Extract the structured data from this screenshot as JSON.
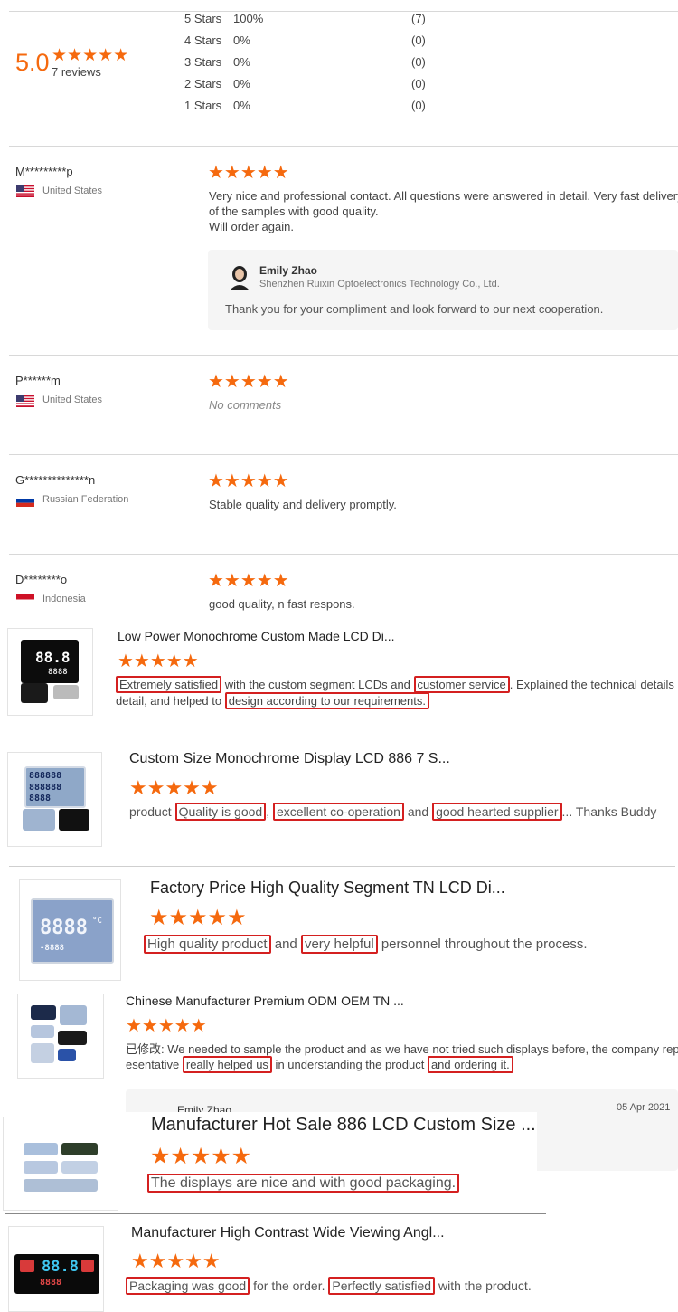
{
  "summary": {
    "score": "5.0",
    "reviews": "7 reviews",
    "breakdown": [
      {
        "label": "5 Stars",
        "pct": "100%",
        "count": "(7)"
      },
      {
        "label": "4 Stars",
        "pct": "0%",
        "count": "(0)"
      },
      {
        "label": "3 Stars",
        "pct": "0%",
        "count": "(0)"
      },
      {
        "label": "2 Stars",
        "pct": "0%",
        "count": "(0)"
      },
      {
        "label": "1 Stars",
        "pct": "0%",
        "count": "(0)"
      }
    ]
  },
  "stars": "★★★★★",
  "reviews": [
    {
      "name": "M*********p",
      "country": "United States",
      "text1": "Very nice and professional contact. All questions were answered in detail. Very fast delivery",
      "text2": "of the samples with good quality.",
      "text3": "Will order again.",
      "reply": {
        "name": "Emily Zhao",
        "company": "Shenzhen Ruixin Optoelectronics Technology Co., Ltd.",
        "text": "Thank you for your compliment and look forward to our next cooperation."
      }
    },
    {
      "name": "P******m",
      "country": "United States",
      "text": "No comments"
    },
    {
      "name": "G**************n",
      "country": "Russian Federation",
      "text": "Stable quality and delivery promptly."
    },
    {
      "name": "D********o",
      "country": "Indonesia",
      "text": "good quality, n fast respons."
    }
  ],
  "products": [
    {
      "title": "Low Power Monochrome Custom Made LCD Di...",
      "h1": "Extremely satisfied",
      "t1": " with the custom segment LCDs and ",
      "h2": "customer service",
      "t2": ". Explained the technical details in",
      "t3": "detail, and helped to ",
      "h3": "design according to our requirements."
    },
    {
      "title": "Custom Size Monochrome Display LCD 886 7 S...",
      "t0": "product ",
      "h1": "Quality is good",
      "t1": ", ",
      "h2": "excellent co-operation",
      "t2": " and ",
      "h3": "good hearted supplier",
      "t3": "... Thanks Buddy"
    },
    {
      "title": "Factory Price High Quality Segment TN LCD Di...",
      "h1": "High quality product",
      "t1": " and ",
      "h2": "very helpful",
      "t2": " personnel throughout the process."
    },
    {
      "title": "Chinese Manufacturer Premium ODM OEM TN ...",
      "t0": "已修改: We needed to sample the product and as we have not tried such displays before, the company repr",
      "t1": "esentative ",
      "h1": "really helped us",
      "t2": " in understanding the product ",
      "h2": "and ordering it.",
      "reply_name": "Emily Zhao",
      "reply_date": "05 Apr 2021"
    },
    {
      "title": "Manufacturer Hot Sale 886 LCD Custom Size ...",
      "h1": "The displays are nice and with good packaging."
    },
    {
      "title": "Manufacturer High Contrast Wide Viewing Angl...",
      "h1": "Packaging was good",
      "t1": " for the order. ",
      "h2": "Perfectly satisfied",
      "t2": " with the product."
    }
  ],
  "lcd": {
    "a": "88.8",
    "b": "88.8",
    "c": "888888",
    "d": "8888",
    "e": "-8888",
    "f": "°C"
  },
  "colors": {
    "accent": "#f5690e",
    "highlight": "#d42020"
  }
}
